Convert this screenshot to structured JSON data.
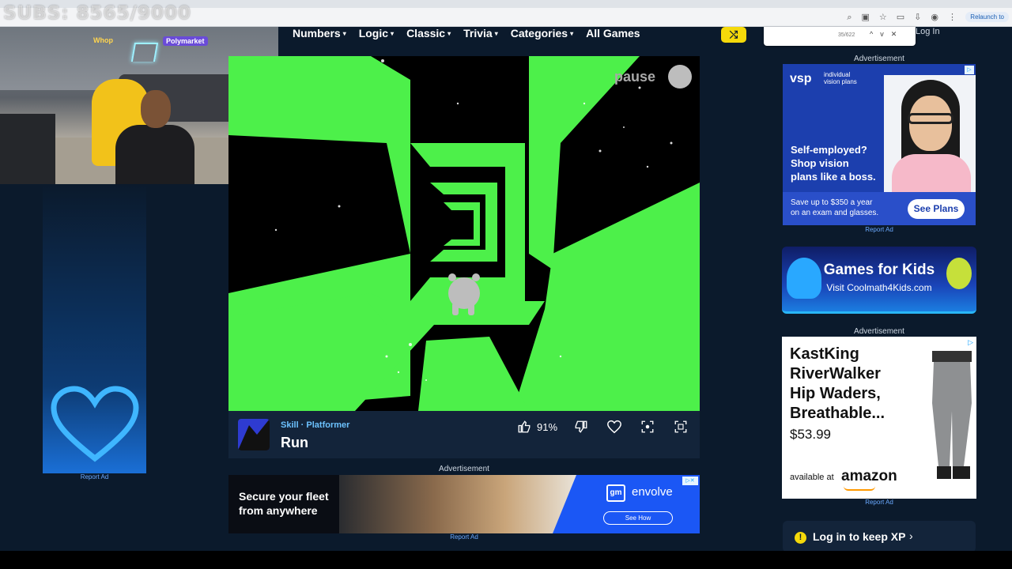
{
  "stream": {
    "subs_overlay": "SUBS: 8565/9000"
  },
  "browser": {
    "relaunch": "Relaunch to"
  },
  "nav": {
    "items": [
      {
        "label": "Numbers",
        "caret": true
      },
      {
        "label": "Logic",
        "caret": true
      },
      {
        "label": "Classic",
        "caret": true
      },
      {
        "label": "Trivia",
        "caret": true
      },
      {
        "label": "Categories",
        "caret": true
      },
      {
        "label": "All Games",
        "caret": false
      }
    ],
    "login": "Log In"
  },
  "findbar": {
    "count": "35/622",
    "prev": "^",
    "next": "v",
    "close": "✕"
  },
  "webcam": {
    "logo_left": "Whop",
    "logo_right": "Polymarket"
  },
  "game": {
    "pause_label": "pause",
    "category": "Skill · Platformer",
    "title": "Run",
    "like_percent": "91%"
  },
  "ads": {
    "advertisement_label": "Advertisement",
    "report_ad": "Report Ad",
    "bottom": {
      "headline_line1": "Secure your fleet",
      "headline_line2": "from anywhere",
      "brand_logo": "gm",
      "brand": "envolve",
      "cta": "See How"
    },
    "vsp": {
      "logo": "vsp",
      "logo_sub_line1": "individual",
      "logo_sub_line2": "vision plans",
      "headline_line1": "Self-employed?",
      "headline_line2": "Shop vision",
      "headline_line3": "plans like a boss.",
      "save_line1": "Save up to $350 a year",
      "save_line2": "on an exam and glasses.",
      "cta": "See Plans"
    },
    "kids": {
      "title": "Games for Kids",
      "subtitle": "Visit Coolmath4Kids.com"
    },
    "kastking": {
      "title_line1": "KastKing",
      "title_line2": "RiverWalker",
      "title_line3": "Hip Waders,",
      "title_line4": "Breathable...",
      "price": "$53.99",
      "available": "available at",
      "store": "amazon"
    }
  },
  "xp": {
    "label": "Log in to keep XP",
    "icon": "!"
  }
}
